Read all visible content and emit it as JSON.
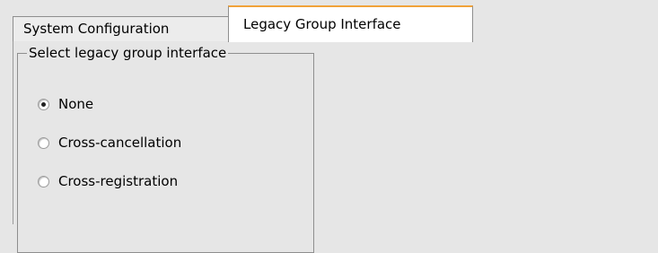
{
  "tabs": [
    {
      "label": "System Configuration",
      "active": false
    },
    {
      "label": "Legacy Group Interface",
      "active": true
    }
  ],
  "group": {
    "legend": "Select legacy group interface",
    "options": [
      {
        "label": "None",
        "selected": true
      },
      {
        "label": "Cross-cancellation",
        "selected": false
      },
      {
        "label": "Cross-registration",
        "selected": false
      }
    ]
  },
  "colors": {
    "background": "#e6e6e6",
    "active_tab_background": "#ffffff",
    "active_tab_accent": "#f1a23a",
    "border": "#8e8e8e"
  }
}
